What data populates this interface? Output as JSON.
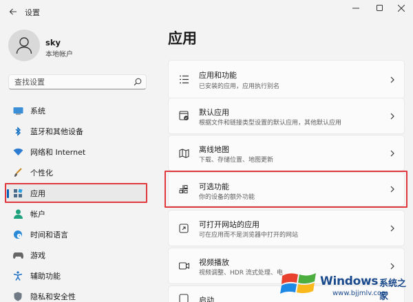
{
  "window": {
    "title": "设置"
  },
  "user": {
    "name": "sky",
    "account_type": "本地帐户"
  },
  "search": {
    "placeholder": "查找设置"
  },
  "sidebar": {
    "items": [
      {
        "label": "系统",
        "icon": "monitor-icon"
      },
      {
        "label": "蓝牙和其他设备",
        "icon": "bluetooth-icon"
      },
      {
        "label": "网络和 Internet",
        "icon": "wifi-icon"
      },
      {
        "label": "个性化",
        "icon": "brush-icon"
      },
      {
        "label": "应用",
        "icon": "apps-icon",
        "active": true
      },
      {
        "label": "帐户",
        "icon": "person-icon"
      },
      {
        "label": "时间和语言",
        "icon": "globe-clock-icon"
      },
      {
        "label": "游戏",
        "icon": "gamepad-icon"
      },
      {
        "label": "辅助功能",
        "icon": "accessibility-icon"
      },
      {
        "label": "隐私和安全性",
        "icon": "shield-icon"
      }
    ]
  },
  "main": {
    "title": "应用",
    "cards": [
      {
        "title": "应用和功能",
        "desc": "已安装的应用，应用执行别名",
        "icon": "list-icon"
      },
      {
        "title": "默认应用",
        "desc": "根据文件和链接类型设置的默认应用，其他默认应用",
        "icon": "default-app-icon"
      },
      {
        "title": "离线地图",
        "desc": "下载、存储位置、地图更新",
        "icon": "map-icon"
      },
      {
        "title": "可选功能",
        "desc": "你的设备的额外功能",
        "icon": "optional-features-icon"
      },
      {
        "title": "可打开网站的应用",
        "desc": "可在应用而不是浏览器中打开的网站",
        "icon": "open-web-icon"
      },
      {
        "title": "视频播放",
        "desc": "视频调整、HDR 流式处理、电",
        "icon": "video-icon"
      },
      {
        "title": "启动",
        "desc": "",
        "icon": "startup-icon"
      }
    ]
  },
  "watermark": {
    "brand": "Windows",
    "suffix": "系统之家",
    "url": "www.bjjmlv.com"
  },
  "colors": {
    "accent": "#005fb8",
    "highlight": "#e0353b",
    "background": "#f3f3f3",
    "card": "#fbfbfb"
  }
}
